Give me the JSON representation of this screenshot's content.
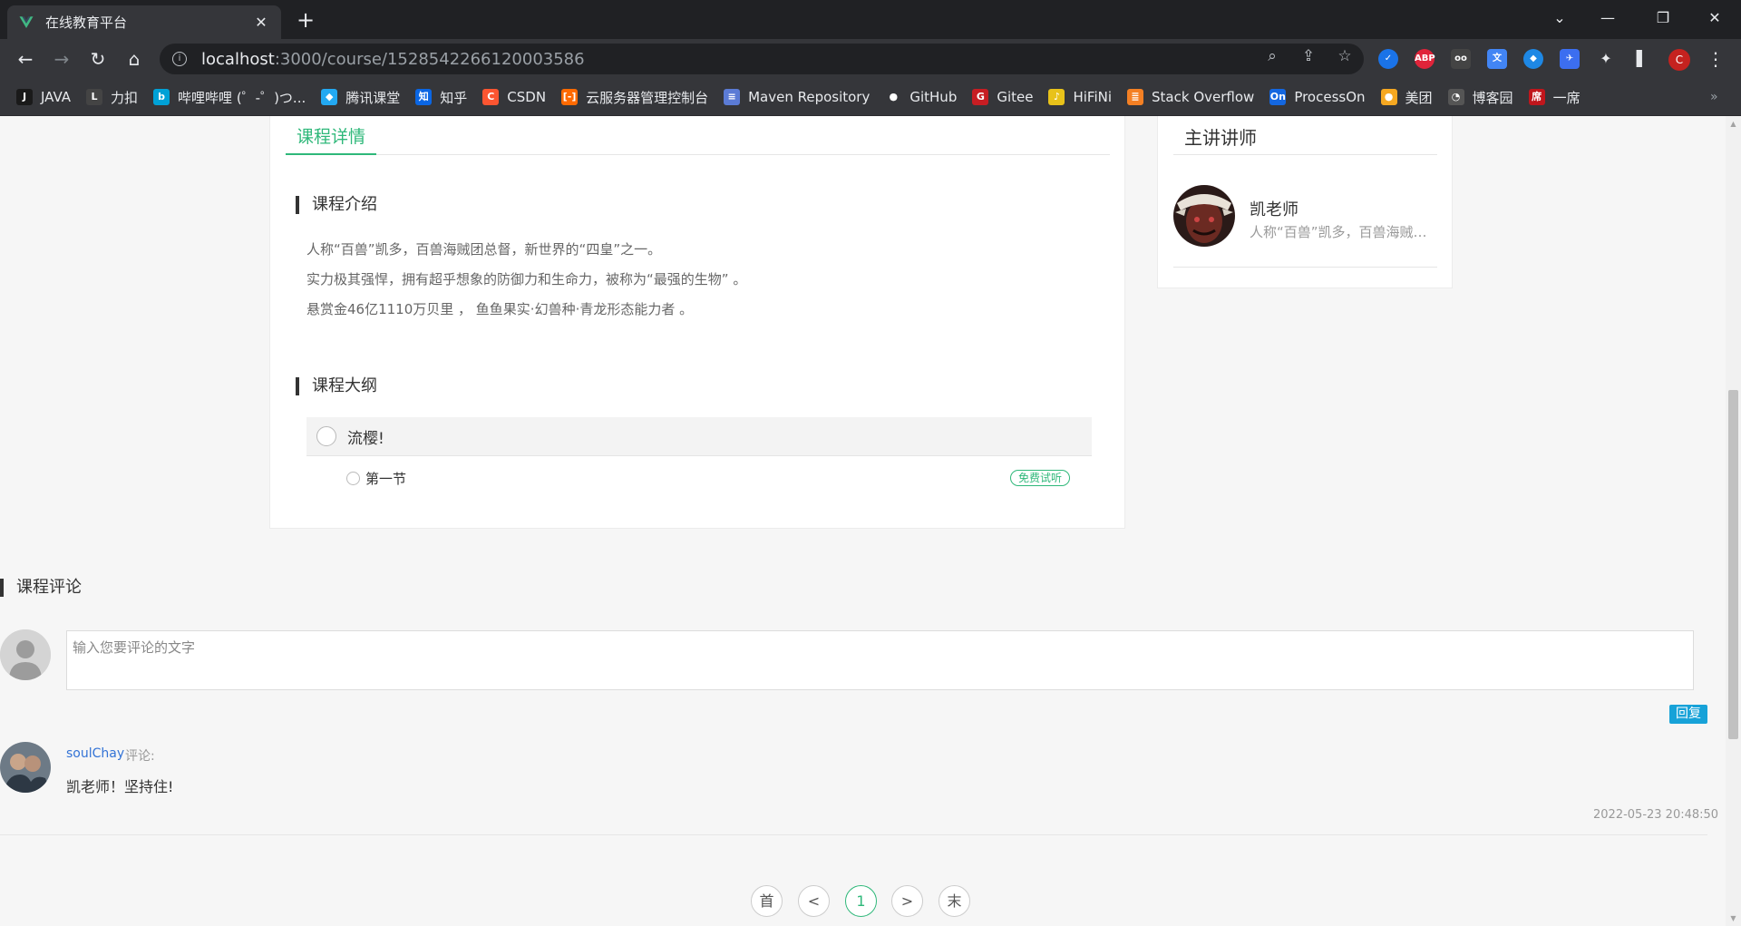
{
  "browser": {
    "tab_title": "在线教育平台",
    "url_host": "localhost",
    "url_path": ":3000/course/1528542266120003586",
    "profile_initial": "C",
    "bookmarks": [
      {
        "label": "JAVA",
        "icon": "java-icon",
        "color": "#1a1a1a"
      },
      {
        "label": "力扣",
        "icon": "leetcode-icon",
        "color": "#444444"
      },
      {
        "label": "哔哩哔哩 (゜-゜)つ...",
        "icon": "bilibili-icon",
        "color": "#00a1d6"
      },
      {
        "label": "腾讯课堂",
        "icon": "tencent-class-icon",
        "color": "#23a9f2"
      },
      {
        "label": "知乎",
        "icon": "zhihu-icon",
        "color": "#0a66e4"
      },
      {
        "label": "CSDN",
        "icon": "csdn-icon",
        "color": "#fc5531"
      },
      {
        "label": "云服务器管理控制台",
        "icon": "aliyun-icon",
        "color": "#ff6a00"
      },
      {
        "label": "Maven Repository",
        "icon": "maven-icon",
        "color": "#5b7bd5"
      },
      {
        "label": "GitHub",
        "icon": "github-icon",
        "color": "#35363a"
      },
      {
        "label": "Gitee",
        "icon": "gitee-icon",
        "color": "#c71d23"
      },
      {
        "label": "HiFiNi",
        "icon": "hifini-icon",
        "color": "#e8c21a"
      },
      {
        "label": "Stack Overflow",
        "icon": "stackoverflow-icon",
        "color": "#f48024"
      },
      {
        "label": "ProcessOn",
        "icon": "processon-icon",
        "color": "#1467e0"
      },
      {
        "label": "美团",
        "icon": "meituan-icon",
        "color": "#f6a821"
      },
      {
        "label": "博客园",
        "icon": "cnblogs-icon",
        "color": "#555555"
      },
      {
        "label": "一席",
        "icon": "yixi-icon",
        "color": "#c0161c"
      }
    ]
  },
  "course": {
    "tab_label": "课程详情",
    "intro_heading": "课程介绍",
    "intro_lines": [
      "人称“百兽”凯多，百兽海贼团总督，新世界的“四皇”之一。",
      "实力极其强悍，拥有超乎想象的防御力和生命力，被称为“最强的生物” 。",
      "悬赏金46亿1110万贝里 ， 鱼鱼果实·幻兽种·青龙形态能力者 。"
    ],
    "outline_heading": "课程大纲",
    "chapters": [
      {
        "title": "流樱!",
        "sections": [
          {
            "title": "第一节",
            "badge": "免费试听"
          }
        ]
      }
    ]
  },
  "teacher": {
    "heading": "主讲讲师",
    "name": "凯老师",
    "desc": "人称“百兽”凯多，百兽海贼团总督，新世界的“四皇”之一。"
  },
  "comments": {
    "heading": "课程评论",
    "input_placeholder": "输入您要评论的文字",
    "reply_label": "回复",
    "items": [
      {
        "user": "soulChay",
        "label": "评论:",
        "text": "凯老师！坚持住!",
        "time": "2022-05-23 20:48:50"
      }
    ]
  },
  "pagination": {
    "first": "首",
    "prev": "<",
    "current": "1",
    "next": ">",
    "last": "末"
  },
  "colors": {
    "accent_green": "#2fb87a",
    "link_blue": "#3373d6",
    "reply_blue": "#17a2d8"
  }
}
